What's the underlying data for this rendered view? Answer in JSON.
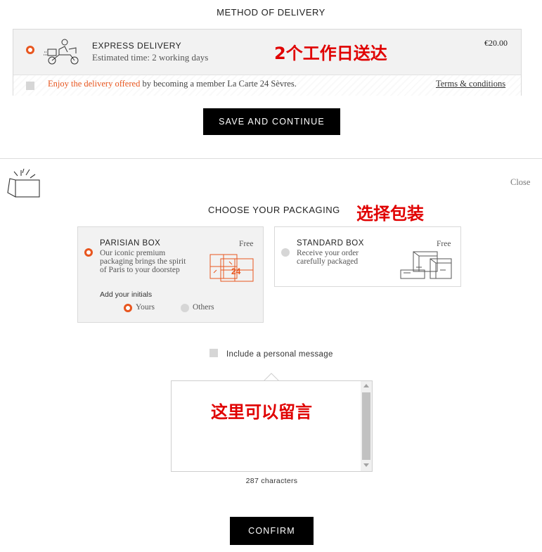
{
  "delivery": {
    "heading": "METHOD OF DELIVERY",
    "option_title": "EXPRESS DELIVERY",
    "option_subtitle": "Estimated time: 2 working days",
    "price": "€20.00",
    "annotation": "2个工作日送达",
    "promo_highlight": "Enjoy the delivery offered",
    "promo_rest": " by becoming a member La Carte 24 Sèvres.",
    "terms_link": "Terms & conditions",
    "save_button": "SAVE AND CONTINUE"
  },
  "packaging": {
    "close_label": "Close",
    "heading": "CHOOSE YOUR PACKAGING",
    "annotation": "选择包装",
    "parisian": {
      "title": "PARISIAN BOX",
      "price": "Free",
      "description_lines": [
        "Our iconic premium",
        "packaging brings the spirit",
        "of Paris to your doorstep"
      ],
      "initials_label": "Add your initials",
      "initials_options": [
        "Yours",
        "Others"
      ],
      "box_text": "24"
    },
    "standard": {
      "title": "STANDARD BOX",
      "price": "Free",
      "description_lines": [
        "Receive your order",
        "carefully packaged"
      ]
    },
    "message_checkbox_label": "Include a personal message",
    "message_annotation": "这里可以留言",
    "message_value": "",
    "char_counter": "287 characters",
    "confirm_button": "CONFIRM"
  },
  "colors": {
    "accent": "#e8561f",
    "annotation": "#e00000",
    "button_bg": "#000000"
  }
}
